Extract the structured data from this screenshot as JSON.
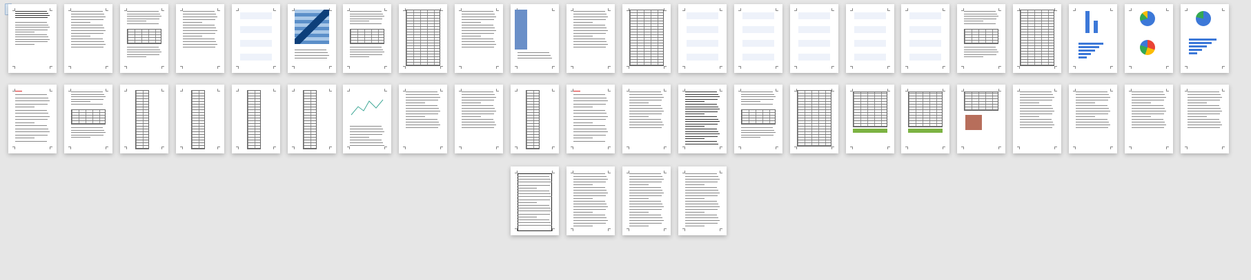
{
  "viewer": {
    "icon": "document-icon"
  },
  "pages": [
    {
      "row": 0,
      "col": 0,
      "kind": "text-title"
    },
    {
      "row": 0,
      "col": 1,
      "kind": "text"
    },
    {
      "row": 0,
      "col": 2,
      "kind": "text-table"
    },
    {
      "row": 0,
      "col": 3,
      "kind": "text"
    },
    {
      "row": 0,
      "col": 4,
      "kind": "light-charts"
    },
    {
      "row": 0,
      "col": 5,
      "kind": "heatmap"
    },
    {
      "row": 0,
      "col": 6,
      "kind": "text-table"
    },
    {
      "row": 0,
      "col": 7,
      "kind": "dense-table"
    },
    {
      "row": 0,
      "col": 8,
      "kind": "text"
    },
    {
      "row": 0,
      "col": 9,
      "kind": "sidebar"
    },
    {
      "row": 0,
      "col": 10,
      "kind": "text"
    },
    {
      "row": 0,
      "col": 11,
      "kind": "dense-table"
    },
    {
      "row": 0,
      "col": 12,
      "kind": "light-charts"
    },
    {
      "row": 0,
      "col": 13,
      "kind": "light-charts"
    },
    {
      "row": 0,
      "col": 14,
      "kind": "light-charts"
    },
    {
      "row": 0,
      "col": 15,
      "kind": "light-charts"
    },
    {
      "row": 0,
      "col": 16,
      "kind": "light-charts"
    },
    {
      "row": 0,
      "col": 17,
      "kind": "text-table"
    },
    {
      "row": 0,
      "col": 18,
      "kind": "dense-table"
    },
    {
      "row": 0,
      "col": 19,
      "kind": "bars"
    },
    {
      "row": 0,
      "col": 20,
      "kind": "pies"
    },
    {
      "row": 0,
      "col": 21,
      "kind": "pie-bars"
    },
    {
      "row": 1,
      "col": 0,
      "kind": "text-red"
    },
    {
      "row": 1,
      "col": 1,
      "kind": "text-table"
    },
    {
      "row": 1,
      "col": 2,
      "kind": "narrow-table"
    },
    {
      "row": 1,
      "col": 3,
      "kind": "narrow-table"
    },
    {
      "row": 1,
      "col": 4,
      "kind": "narrow-table"
    },
    {
      "row": 1,
      "col": 5,
      "kind": "narrow-table"
    },
    {
      "row": 1,
      "col": 6,
      "kind": "line-chart"
    },
    {
      "row": 1,
      "col": 7,
      "kind": "text"
    },
    {
      "row": 1,
      "col": 8,
      "kind": "text"
    },
    {
      "row": 1,
      "col": 9,
      "kind": "narrow-table"
    },
    {
      "row": 1,
      "col": 10,
      "kind": "text-red"
    },
    {
      "row": 1,
      "col": 11,
      "kind": "text"
    },
    {
      "row": 1,
      "col": 12,
      "kind": "dense-text"
    },
    {
      "row": 1,
      "col": 13,
      "kind": "text-table"
    },
    {
      "row": 1,
      "col": 14,
      "kind": "dense-table"
    },
    {
      "row": 1,
      "col": 15,
      "kind": "excel"
    },
    {
      "row": 1,
      "col": 16,
      "kind": "excel"
    },
    {
      "row": 1,
      "col": 17,
      "kind": "excel-chart"
    },
    {
      "row": 1,
      "col": 18,
      "kind": "text"
    },
    {
      "row": 1,
      "col": 19,
      "kind": "text"
    },
    {
      "row": 1,
      "col": 20,
      "kind": "text"
    },
    {
      "row": 1,
      "col": 21,
      "kind": "text"
    },
    {
      "row": 2,
      "col": 9,
      "kind": "code-box"
    },
    {
      "row": 2,
      "col": 10,
      "kind": "code"
    },
    {
      "row": 2,
      "col": 11,
      "kind": "code"
    },
    {
      "row": 2,
      "col": 12,
      "kind": "code"
    }
  ]
}
